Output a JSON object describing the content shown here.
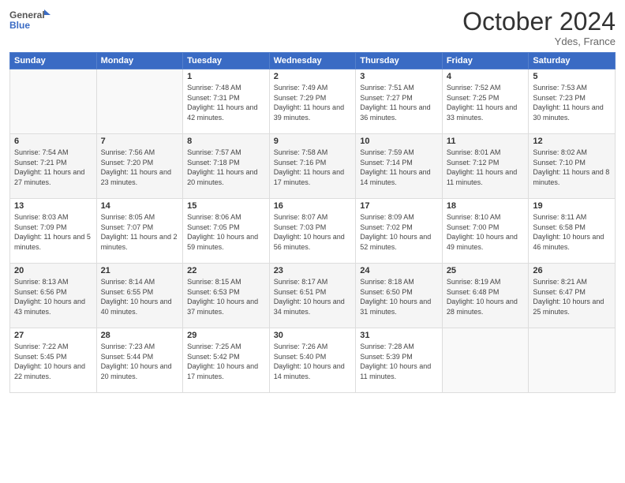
{
  "header": {
    "logo_line1": "General",
    "logo_line2": "Blue",
    "month": "October 2024",
    "location": "Ydes, France"
  },
  "days_of_week": [
    "Sunday",
    "Monday",
    "Tuesday",
    "Wednesday",
    "Thursday",
    "Friday",
    "Saturday"
  ],
  "weeks": [
    [
      {
        "day": "",
        "sunrise": "",
        "sunset": "",
        "daylight": ""
      },
      {
        "day": "",
        "sunrise": "",
        "sunset": "",
        "daylight": ""
      },
      {
        "day": "1",
        "sunrise": "Sunrise: 7:48 AM",
        "sunset": "Sunset: 7:31 PM",
        "daylight": "Daylight: 11 hours and 42 minutes."
      },
      {
        "day": "2",
        "sunrise": "Sunrise: 7:49 AM",
        "sunset": "Sunset: 7:29 PM",
        "daylight": "Daylight: 11 hours and 39 minutes."
      },
      {
        "day": "3",
        "sunrise": "Sunrise: 7:51 AM",
        "sunset": "Sunset: 7:27 PM",
        "daylight": "Daylight: 11 hours and 36 minutes."
      },
      {
        "day": "4",
        "sunrise": "Sunrise: 7:52 AM",
        "sunset": "Sunset: 7:25 PM",
        "daylight": "Daylight: 11 hours and 33 minutes."
      },
      {
        "day": "5",
        "sunrise": "Sunrise: 7:53 AM",
        "sunset": "Sunset: 7:23 PM",
        "daylight": "Daylight: 11 hours and 30 minutes."
      }
    ],
    [
      {
        "day": "6",
        "sunrise": "Sunrise: 7:54 AM",
        "sunset": "Sunset: 7:21 PM",
        "daylight": "Daylight: 11 hours and 27 minutes."
      },
      {
        "day": "7",
        "sunrise": "Sunrise: 7:56 AM",
        "sunset": "Sunset: 7:20 PM",
        "daylight": "Daylight: 11 hours and 23 minutes."
      },
      {
        "day": "8",
        "sunrise": "Sunrise: 7:57 AM",
        "sunset": "Sunset: 7:18 PM",
        "daylight": "Daylight: 11 hours and 20 minutes."
      },
      {
        "day": "9",
        "sunrise": "Sunrise: 7:58 AM",
        "sunset": "Sunset: 7:16 PM",
        "daylight": "Daylight: 11 hours and 17 minutes."
      },
      {
        "day": "10",
        "sunrise": "Sunrise: 7:59 AM",
        "sunset": "Sunset: 7:14 PM",
        "daylight": "Daylight: 11 hours and 14 minutes."
      },
      {
        "day": "11",
        "sunrise": "Sunrise: 8:01 AM",
        "sunset": "Sunset: 7:12 PM",
        "daylight": "Daylight: 11 hours and 11 minutes."
      },
      {
        "day": "12",
        "sunrise": "Sunrise: 8:02 AM",
        "sunset": "Sunset: 7:10 PM",
        "daylight": "Daylight: 11 hours and 8 minutes."
      }
    ],
    [
      {
        "day": "13",
        "sunrise": "Sunrise: 8:03 AM",
        "sunset": "Sunset: 7:09 PM",
        "daylight": "Daylight: 11 hours and 5 minutes."
      },
      {
        "day": "14",
        "sunrise": "Sunrise: 8:05 AM",
        "sunset": "Sunset: 7:07 PM",
        "daylight": "Daylight: 11 hours and 2 minutes."
      },
      {
        "day": "15",
        "sunrise": "Sunrise: 8:06 AM",
        "sunset": "Sunset: 7:05 PM",
        "daylight": "Daylight: 10 hours and 59 minutes."
      },
      {
        "day": "16",
        "sunrise": "Sunrise: 8:07 AM",
        "sunset": "Sunset: 7:03 PM",
        "daylight": "Daylight: 10 hours and 56 minutes."
      },
      {
        "day": "17",
        "sunrise": "Sunrise: 8:09 AM",
        "sunset": "Sunset: 7:02 PM",
        "daylight": "Daylight: 10 hours and 52 minutes."
      },
      {
        "day": "18",
        "sunrise": "Sunrise: 8:10 AM",
        "sunset": "Sunset: 7:00 PM",
        "daylight": "Daylight: 10 hours and 49 minutes."
      },
      {
        "day": "19",
        "sunrise": "Sunrise: 8:11 AM",
        "sunset": "Sunset: 6:58 PM",
        "daylight": "Daylight: 10 hours and 46 minutes."
      }
    ],
    [
      {
        "day": "20",
        "sunrise": "Sunrise: 8:13 AM",
        "sunset": "Sunset: 6:56 PM",
        "daylight": "Daylight: 10 hours and 43 minutes."
      },
      {
        "day": "21",
        "sunrise": "Sunrise: 8:14 AM",
        "sunset": "Sunset: 6:55 PM",
        "daylight": "Daylight: 10 hours and 40 minutes."
      },
      {
        "day": "22",
        "sunrise": "Sunrise: 8:15 AM",
        "sunset": "Sunset: 6:53 PM",
        "daylight": "Daylight: 10 hours and 37 minutes."
      },
      {
        "day": "23",
        "sunrise": "Sunrise: 8:17 AM",
        "sunset": "Sunset: 6:51 PM",
        "daylight": "Daylight: 10 hours and 34 minutes."
      },
      {
        "day": "24",
        "sunrise": "Sunrise: 8:18 AM",
        "sunset": "Sunset: 6:50 PM",
        "daylight": "Daylight: 10 hours and 31 minutes."
      },
      {
        "day": "25",
        "sunrise": "Sunrise: 8:19 AM",
        "sunset": "Sunset: 6:48 PM",
        "daylight": "Daylight: 10 hours and 28 minutes."
      },
      {
        "day": "26",
        "sunrise": "Sunrise: 8:21 AM",
        "sunset": "Sunset: 6:47 PM",
        "daylight": "Daylight: 10 hours and 25 minutes."
      }
    ],
    [
      {
        "day": "27",
        "sunrise": "Sunrise: 7:22 AM",
        "sunset": "Sunset: 5:45 PM",
        "daylight": "Daylight: 10 hours and 22 minutes."
      },
      {
        "day": "28",
        "sunrise": "Sunrise: 7:23 AM",
        "sunset": "Sunset: 5:44 PM",
        "daylight": "Daylight: 10 hours and 20 minutes."
      },
      {
        "day": "29",
        "sunrise": "Sunrise: 7:25 AM",
        "sunset": "Sunset: 5:42 PM",
        "daylight": "Daylight: 10 hours and 17 minutes."
      },
      {
        "day": "30",
        "sunrise": "Sunrise: 7:26 AM",
        "sunset": "Sunset: 5:40 PM",
        "daylight": "Daylight: 10 hours and 14 minutes."
      },
      {
        "day": "31",
        "sunrise": "Sunrise: 7:28 AM",
        "sunset": "Sunset: 5:39 PM",
        "daylight": "Daylight: 10 hours and 11 minutes."
      },
      {
        "day": "",
        "sunrise": "",
        "sunset": "",
        "daylight": ""
      },
      {
        "day": "",
        "sunrise": "",
        "sunset": "",
        "daylight": ""
      }
    ]
  ]
}
